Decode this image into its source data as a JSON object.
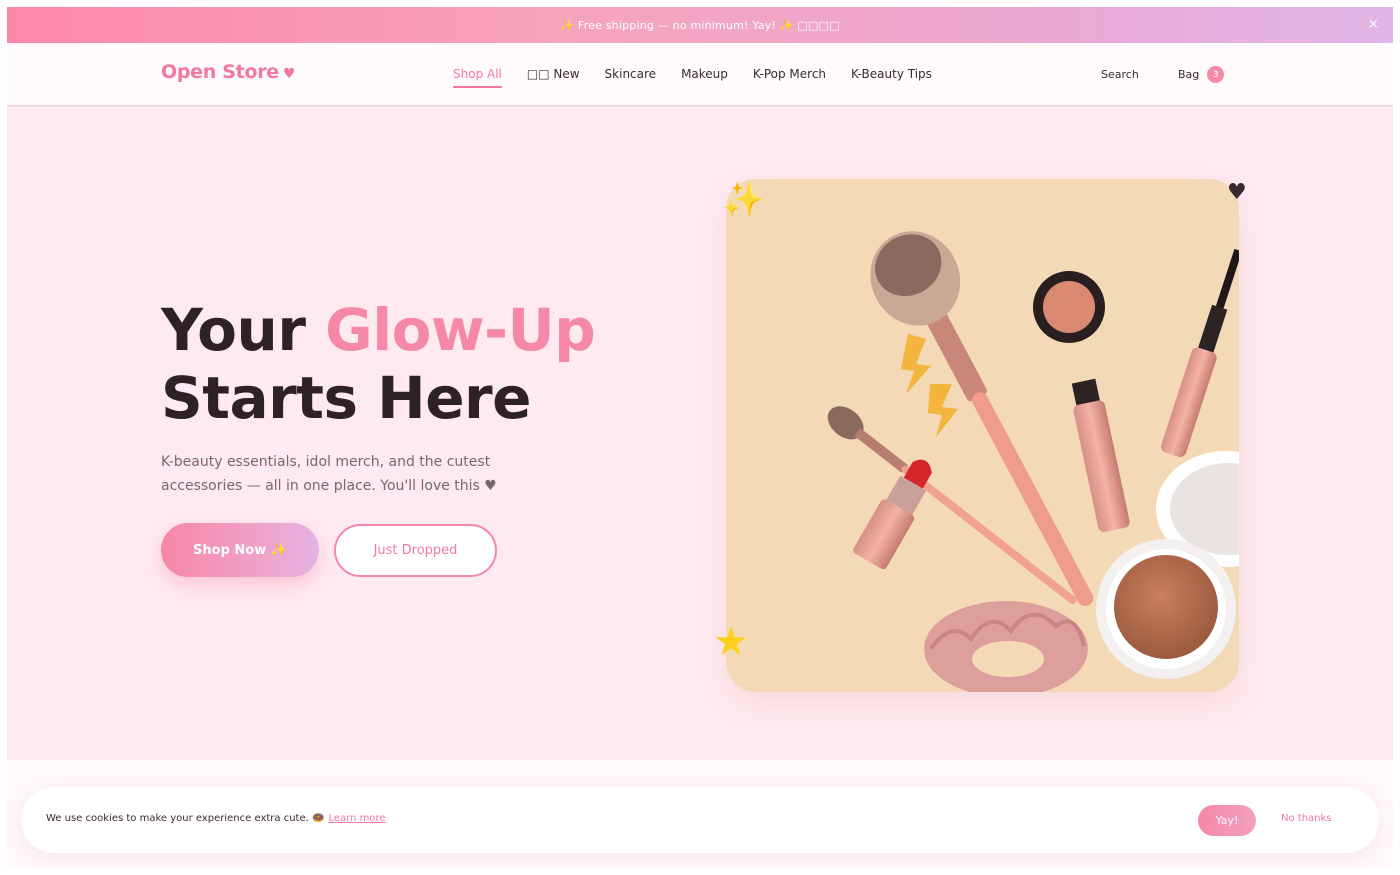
{
  "announcement": {
    "text": "✨ Free shipping — no minimum! Yay! ✨ □□□□",
    "close": "×"
  },
  "header": {
    "logo": "Open Store",
    "logo_heart": "♥",
    "nav": [
      {
        "label": "Shop All",
        "active": true
      },
      {
        "label": "□□ New"
      },
      {
        "label": "Skincare"
      },
      {
        "label": "Makeup"
      },
      {
        "label": "K-Pop Merch"
      },
      {
        "label": "K-Beauty Tips"
      }
    ],
    "search": "Search",
    "bag_label": "Bag",
    "bag_count": "3"
  },
  "hero": {
    "headline_part1": "Your ",
    "headline_accent": "Glow-Up",
    "headline_part2": "Starts Here",
    "subtext": "K-beauty essentials, idol merch, and the cutest accessories — all in one place. You'll love this ♥",
    "primary_button": "Shop Now ✨",
    "secondary_button": "Just Dropped",
    "decor": {
      "sparkle": "✨",
      "heart": "♥",
      "star": "★"
    }
  },
  "cookie": {
    "text": "We use cookies to make your experience extra cute. 🍩",
    "link": "Learn more",
    "accept": "Yay!",
    "decline": "No thanks"
  },
  "colors": {
    "brand_pink": "#f3799c",
    "hero_bg": "#ffeaf1",
    "card_bg": "#f4d9b6",
    "headline": "#2f2128"
  }
}
